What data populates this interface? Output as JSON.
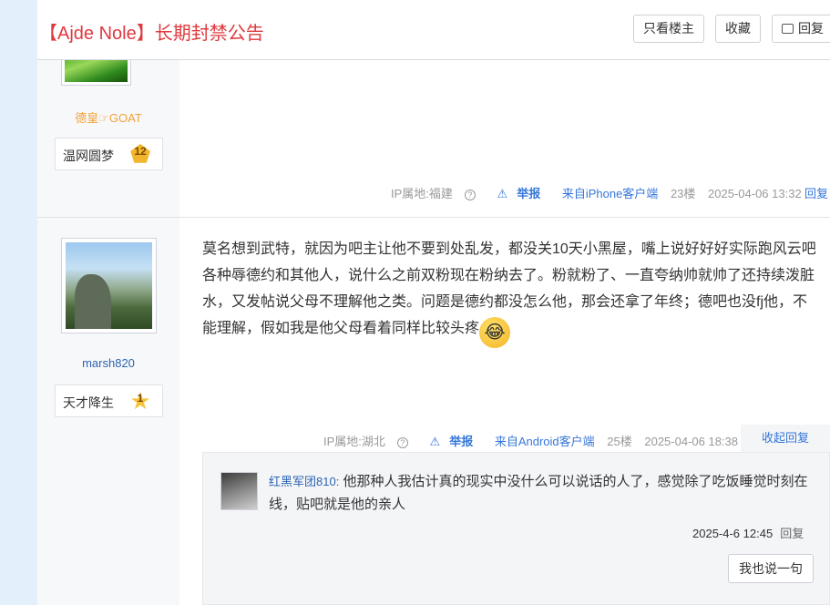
{
  "header": {
    "title": "【Ajde Nole】长期封禁公告",
    "only_op_label": "只看楼主",
    "favorite_label": "收藏",
    "reply_label": "回复"
  },
  "post1": {
    "username": "德皇☞GOAT",
    "badge_title": "温网圆梦",
    "badge_level": "12",
    "ip": "IP属地:福建",
    "report": "举报",
    "source": "来自iPhone客户端",
    "floor": "23楼",
    "time": "2025-04-06 13:32",
    "reply": "回复"
  },
  "post2": {
    "username": "marsh820",
    "badge_title": "天才降生",
    "badge_level": "1",
    "content": "莫名想到武特，就因为吧主让他不要到处乱发，都没关10天小黑屋，嘴上说好好好实际跑风云吧各种辱德约和其他人，说什么之前双粉现在粉纳去了。粉就粉了、一直夸纳帅就帅了还持续泼脏水，又发帖说父母不理解他之类。问题是德约都没怎么他，那会还拿了年终；德吧也没fj他，不能理解，假如我是他父母看着同样比较头疼",
    "ip": "IP属地:湖北",
    "report": "举报",
    "source": "来自Android客户端",
    "floor": "25楼",
    "time": "2025-04-06 18:38",
    "fold_label": "收起回复"
  },
  "reply_box": {
    "replier": "红黑军团810:",
    "text": "他那种人我估计真的现实中没什么可以说话的人了，感觉除了吃饭睡觉时刻在线，贴吧就是他的亲人",
    "time": "2025-4-6 12:45",
    "reply": "回复",
    "say_button": "我也说一句"
  },
  "colors": {
    "title_red": "#e0393e",
    "link_blue": "#3677d9",
    "username_orange": "#f0a33c",
    "username_blue": "#2d64b3"
  }
}
